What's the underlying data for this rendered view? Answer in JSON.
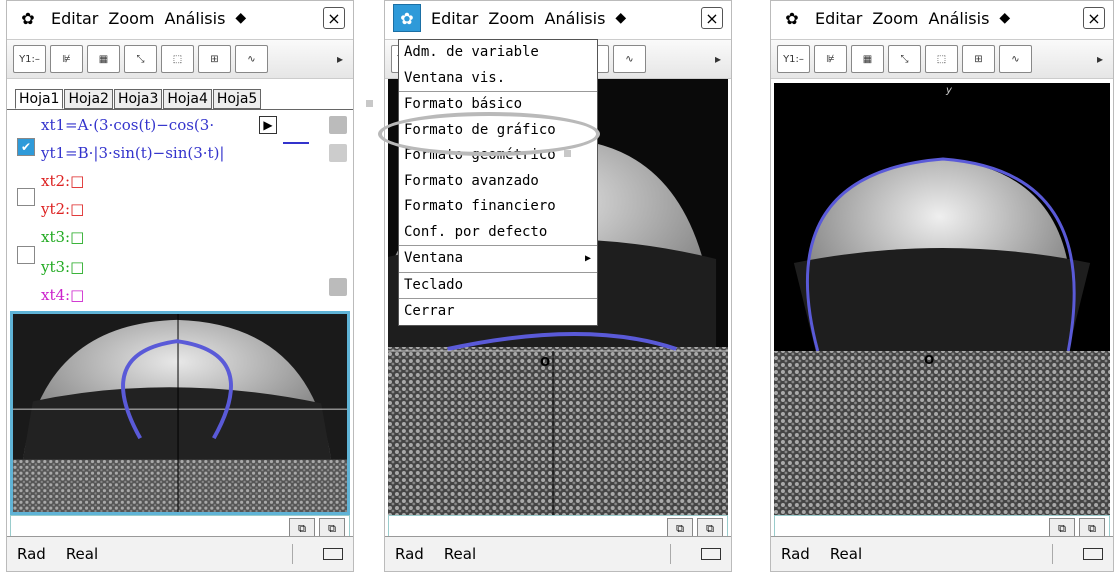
{
  "menubar": {
    "items": [
      "Editar",
      "Zoom",
      "Análisis"
    ],
    "close": "×"
  },
  "toolbar": {
    "arrow": "▸"
  },
  "tabs": [
    "Hoja1",
    "Hoja2",
    "Hoja3",
    "Hoja4",
    "Hoja5"
  ],
  "equations": {
    "xt1": "xt1=A·(3·cos(t)−cos(3·",
    "yt1": "yt1=B·|3·sin(t)−sin(3·t)|",
    "xt2": "xt2:□",
    "yt2": "yt2:□",
    "xt3": "xt3:□",
    "yt3": "yt3:□",
    "xt4": "xt4:□"
  },
  "menu": [
    "Adm. de variable",
    "Ventana vis.",
    "Formato básico",
    "Formato de gráfico",
    "Formato geométrico",
    "Formato avanzado",
    "Formato financiero",
    "Conf. por defecto",
    "Ventana",
    "Teclado",
    "Cerrar"
  ],
  "status": {
    "angle": "Rad",
    "mode": "Real"
  },
  "axis": {
    "origin": "O",
    "y": "y"
  },
  "colors": {
    "accent": "#2e9ad9",
    "curve": "#5a5ad8",
    "xt1": "#3333cc",
    "xt2": "#dd2222",
    "xt3": "#22aa22",
    "xt4": "#cc22cc"
  }
}
